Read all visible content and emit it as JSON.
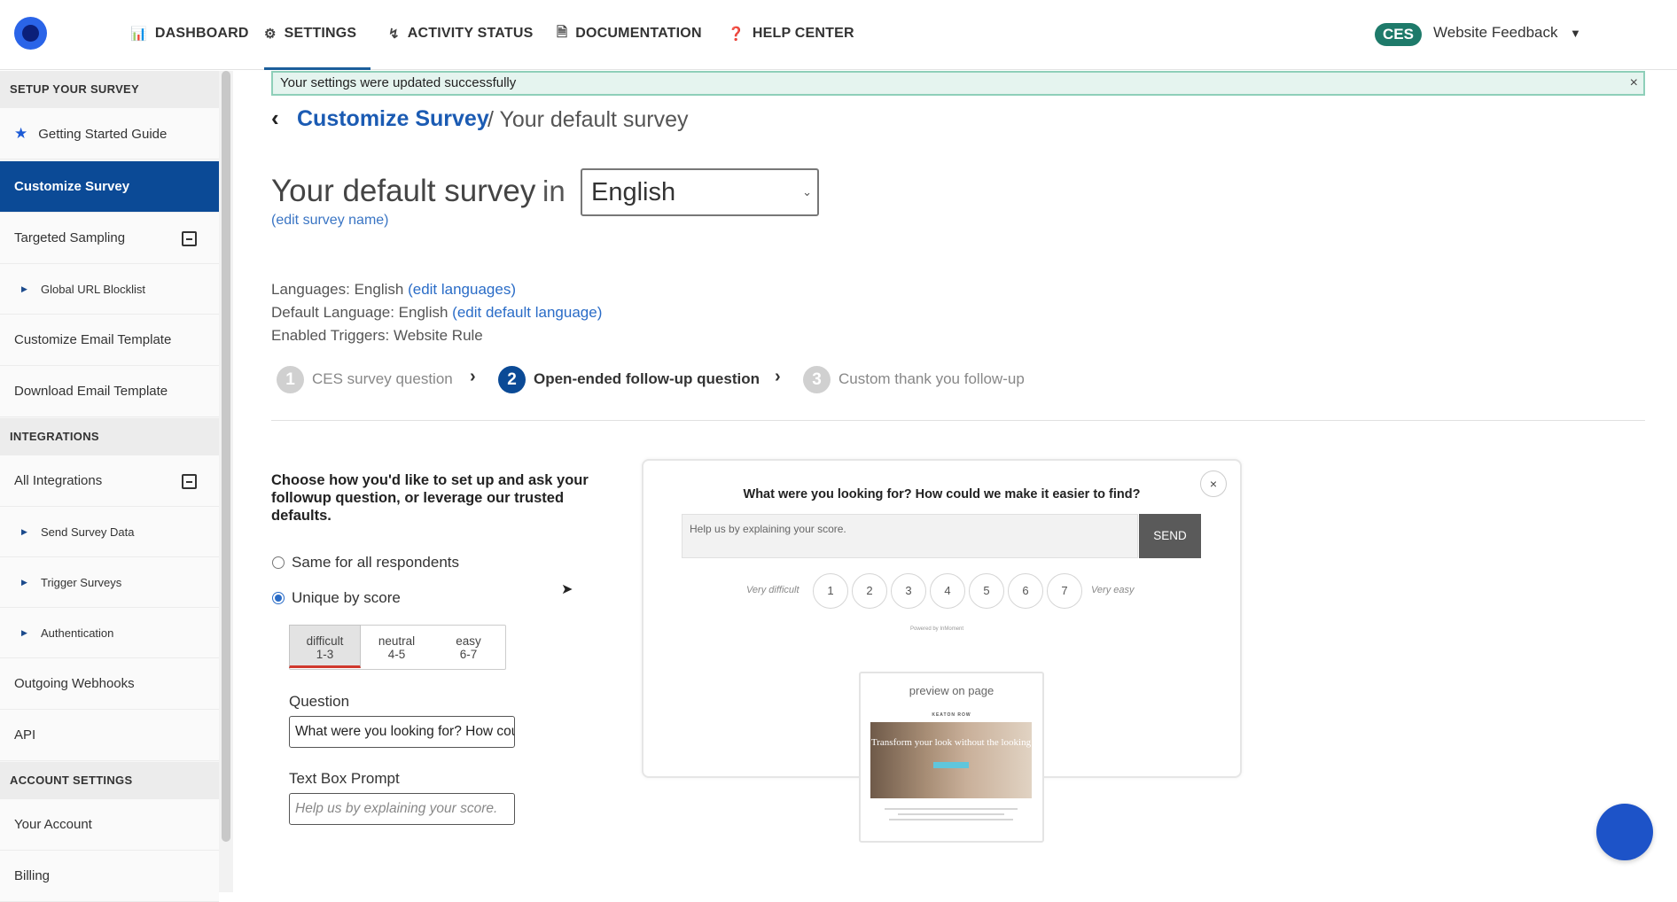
{
  "nav": {
    "items": [
      {
        "label": "DASHBOARD",
        "icon": "bar-chart-icon"
      },
      {
        "label": "SETTINGS",
        "icon": "gear-icon"
      },
      {
        "label": "ACTIVITY STATUS",
        "icon": "pulse-icon"
      },
      {
        "label": "DOCUMENTATION",
        "icon": "document-icon"
      },
      {
        "label": "HELP CENTER",
        "icon": "question-icon"
      }
    ],
    "active": "SETTINGS",
    "badge": "CES",
    "project": "Website Feedback"
  },
  "sidebar": {
    "sections": [
      {
        "title": "SETUP YOUR SURVEY"
      },
      {
        "title": "INTEGRATIONS"
      },
      {
        "title": "ACCOUNT SETTINGS"
      }
    ],
    "items": {
      "getting_started": "Getting Started Guide",
      "customize_survey": "Customize Survey",
      "targeted_sampling": "Targeted Sampling",
      "global_url_blocklist": "Global URL Blocklist",
      "customize_email": "Customize Email Template",
      "download_email": "Download Email Template",
      "all_integrations": "All Integrations",
      "send_survey_data": "Send Survey Data",
      "trigger_surveys": "Trigger Surveys",
      "authentication": "Authentication",
      "outgoing_webhooks": "Outgoing Webhooks",
      "api": "API",
      "your_account": "Your Account",
      "billing": "Billing"
    }
  },
  "alert": {
    "message": "Your settings were updated successfully",
    "close": "×"
  },
  "breadcrumb": {
    "link": "Customize Survey",
    "rest": "/ Your default survey"
  },
  "title": {
    "text": "Your default survey",
    "in": "in",
    "language": "English",
    "edit_name": "(edit survey name)"
  },
  "info": {
    "languages_label": "Languages: English",
    "languages_link": "(edit languages)",
    "default_label": "Default Language: English",
    "default_link": "(edit default language)",
    "triggers": "Enabled Triggers: Website Rule"
  },
  "steps": [
    {
      "num": "1",
      "label": "CES survey question"
    },
    {
      "num": "2",
      "label": "Open-ended follow-up question"
    },
    {
      "num": "3",
      "label": "Custom thank you follow-up"
    }
  ],
  "setup": {
    "intro": "Choose how you'd like to set up and ask your followup question, or leverage our trusted defaults.",
    "option_same": "Same for all respondents",
    "option_unique": "Unique by score",
    "selected": "Unique by score",
    "segments": [
      {
        "name": "difficult",
        "range": "1-3"
      },
      {
        "name": "neutral",
        "range": "4-5"
      },
      {
        "name": "easy",
        "range": "6-7"
      }
    ],
    "question_label": "Question",
    "question_value": "What were you looking for? How could we make it easier to find?",
    "prompt_label": "Text Box Prompt",
    "prompt_placeholder": "Help us by explaining your score."
  },
  "preview": {
    "question": "What were you looking for? How could we make it easier to find?",
    "input_placeholder": "Help us by explaining your score.",
    "send": "SEND",
    "low_label": "Very difficult",
    "high_label": "Very easy",
    "scale": [
      "1",
      "2",
      "3",
      "4",
      "5",
      "6",
      "7"
    ],
    "powered_by": "Powered by InMoment",
    "close": "×",
    "page_label": "preview on page",
    "page_brand": "KEATON ROW",
    "page_hero": "Transform your look without the looking"
  },
  "colors": {
    "accent": "#0b4a96",
    "link": "#2a6cc7",
    "badge": "#1e7a6a",
    "alert_bg": "#e5f4ef"
  }
}
